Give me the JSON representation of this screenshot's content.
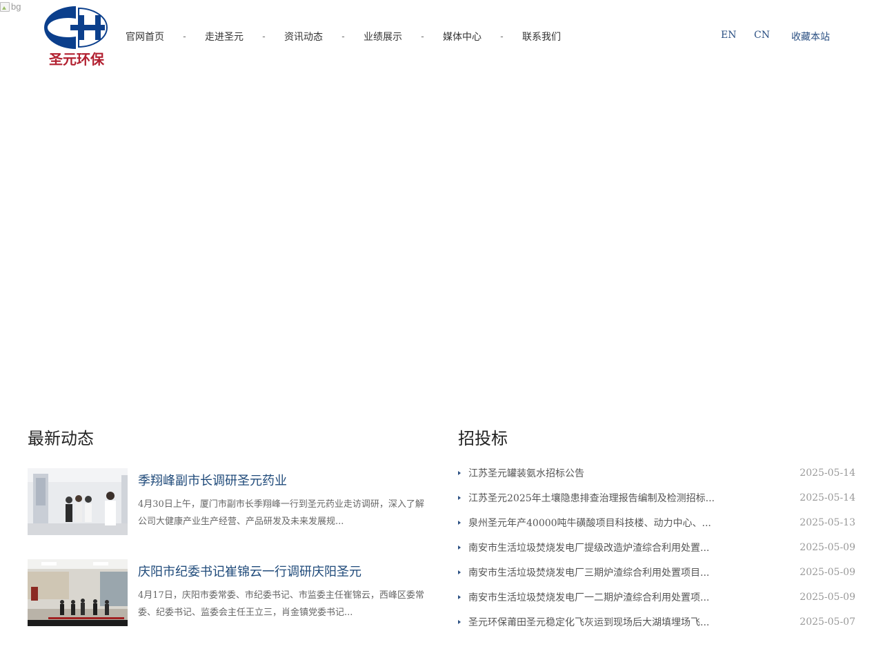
{
  "header": {
    "banner_alt": "bg",
    "logo_text": "圣元环保",
    "nav": [
      "官网首页",
      "走进圣元",
      "资讯动态",
      "业绩展示",
      "媒体中心",
      "联系我们"
    ],
    "nav_separator": "-",
    "lang_en": "EN",
    "lang_cn": "CN",
    "bookmark": "收藏本站"
  },
  "news": {
    "title": "最新动态",
    "items": [
      {
        "title": "季翔峰副市长调研圣元药业",
        "summary": "4月30日上午，厦门市副市长季翔峰一行到圣元药业走访调研，深入了解公司大健康产业生产经营、产品研发及未来发展规..."
      },
      {
        "title": "庆阳市纪委书记崔锦云一行调研庆阳圣元",
        "summary": "4月17日，庆阳市委常委、市纪委书记、市监委主任崔锦云，西峰区委常委、纪委书记、监委会主任王立三，肖金镇党委书记..."
      }
    ]
  },
  "tenders": {
    "title": "招投标",
    "items": [
      {
        "title": "江苏圣元罐装氨水招标公告",
        "date": "2025-05-14"
      },
      {
        "title": "江苏圣元2025年土壤隐患排查治理报告编制及检测招标...",
        "date": "2025-05-14"
      },
      {
        "title": "泉州圣元年产40000吨牛磺酸项目科技楼、动力中心、...",
        "date": "2025-05-13"
      },
      {
        "title": "南安市生活垃圾焚烧发电厂提级改造炉渣综合利用处置...",
        "date": "2025-05-09"
      },
      {
        "title": "南安市生活垃圾焚烧发电厂三期炉渣综合利用处置项目...",
        "date": "2025-05-09"
      },
      {
        "title": "南安市生活垃圾焚烧发电厂一二期炉渣综合利用处置项...",
        "date": "2025-05-09"
      },
      {
        "title": "圣元环保莆田圣元稳定化飞灰运到现场后大湖填埋场飞...",
        "date": "2025-05-07"
      }
    ]
  },
  "colors": {
    "brand_blue": "#0b3f8c",
    "brand_red": "#b22030",
    "link_blue": "#1f4a7a"
  }
}
